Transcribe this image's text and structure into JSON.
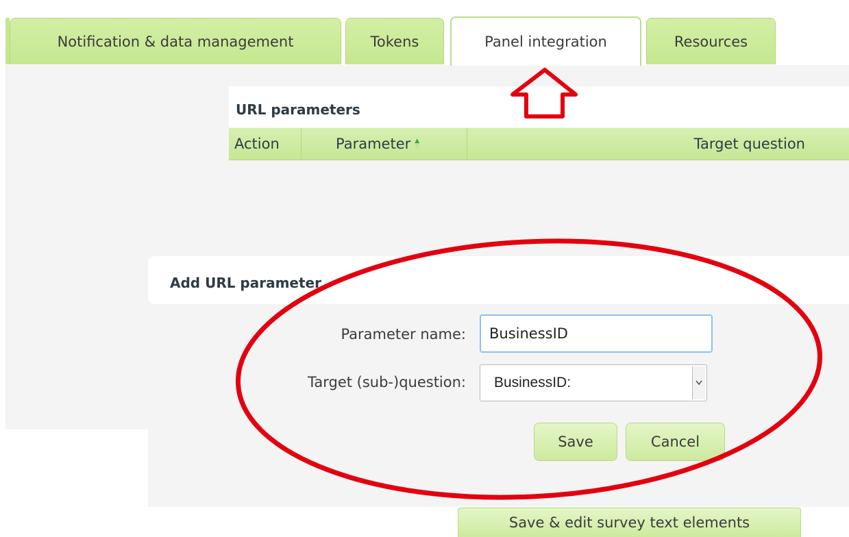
{
  "tabs": [
    {
      "label": "Notification & data management",
      "active": false
    },
    {
      "label": "Tokens",
      "active": false
    },
    {
      "label": "Panel integration",
      "active": true
    },
    {
      "label": "Resources",
      "active": false
    }
  ],
  "url_parameters": {
    "title": "URL parameters",
    "columns": [
      "Action",
      "Parameter",
      "Target question"
    ],
    "rows": []
  },
  "add_dialog": {
    "title": "Add URL parameter",
    "parameter_name_label": "Parameter name:",
    "parameter_name_value": "BusinessID",
    "target_label": "Target (sub-)question:",
    "target_value": "BusinessID:",
    "save_label": "Save",
    "cancel_label": "Cancel"
  },
  "footer": {
    "save_edit_label": "Save & edit survey text elements"
  },
  "colors": {
    "tab_green": "#c5e88f",
    "header_green": "#c7e796",
    "annotation_red": "#e3000f"
  },
  "icons": {
    "sort": "sort-arrows-icon",
    "dropdown": "chevron-down-icon"
  }
}
